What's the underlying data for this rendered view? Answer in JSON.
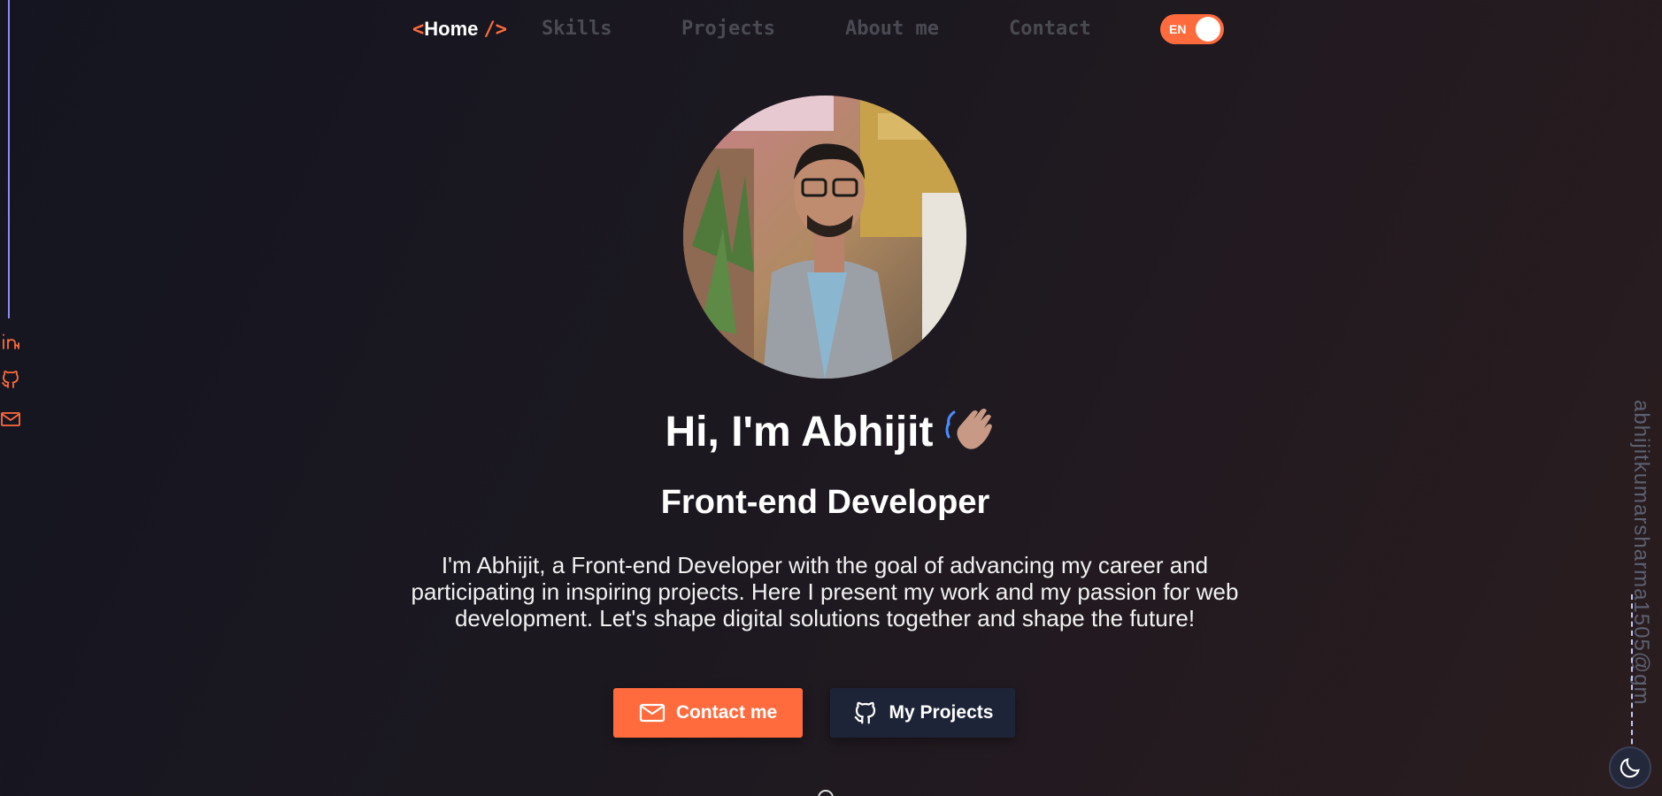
{
  "nav": {
    "home_open": "<",
    "home_label": "Home",
    "home_close": "/>",
    "items": [
      "Skills",
      "Projects",
      "About me",
      "Contact"
    ],
    "lang_toggle": "EN"
  },
  "social": {
    "icons": [
      "linkedin-icon",
      "github-icon",
      "mail-icon"
    ]
  },
  "email_vertical": "abhijitkumarsharma1505@gm",
  "hero": {
    "title": "Hi, I'm Abhijit",
    "subtitle": "Front-end Developer",
    "description": "I'm Abhijit, a Front-end Developer with the goal of advancing my career and participating in inspiring projects. Here I present my work and my passion for web development. Let's shape digital solutions together and shape the future!",
    "contact_button": "Contact me",
    "projects_button": "My Projects"
  },
  "colors": {
    "accent": "#ff6b3d",
    "secondary_button": "#1e2438",
    "nav_inactive": "#4a4a52",
    "sidebar_line": "#8a8cf0"
  }
}
